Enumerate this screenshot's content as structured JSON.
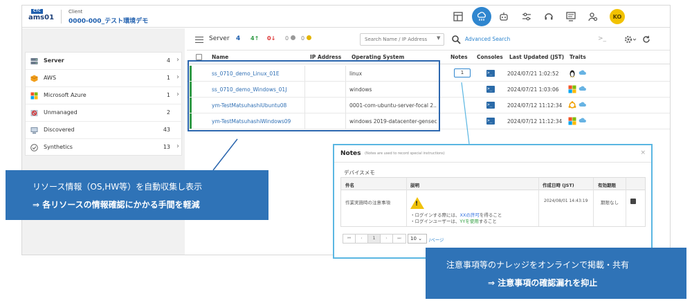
{
  "header": {
    "logo_top": "CTC",
    "logo_text": "ams01",
    "client_label": "Client",
    "client_name": "0000-000_テスト環境デモ",
    "avatar_initials": "KO",
    "accent": "#2f86cf"
  },
  "sidebar": {
    "items": [
      {
        "label": "Server",
        "count": "4",
        "chevron": "›",
        "icon": "server-icon"
      },
      {
        "label": "AWS",
        "count": "1",
        "chevron": "›",
        "icon": "aws-icon"
      },
      {
        "label": "Microsoft Azure",
        "count": "1",
        "chevron": "›",
        "icon": "windows-icon"
      },
      {
        "label": "Unmanaged",
        "count": "2",
        "chevron": "",
        "icon": "unmanaged-icon"
      },
      {
        "label": "Discovered",
        "count": "43",
        "chevron": "",
        "icon": "discovered-icon"
      },
      {
        "label": "Synthetics",
        "count": "13",
        "chevron": "›",
        "icon": "synthetics-icon"
      }
    ]
  },
  "toolbar": {
    "title": "Server",
    "count": "4",
    "up_count": "4",
    "down_count": "0",
    "unknown_count": "0",
    "question_count": "0",
    "search_placeholder": "Search Name / IP Address",
    "advanced_search": "Advanced Search",
    "console_glyph": ">_"
  },
  "table": {
    "headers": {
      "name": "Name",
      "ip": "IP Address",
      "os": "Operating System",
      "notes": "Notes",
      "consoles": "Consoles",
      "updated": "Last Updated (JST)",
      "traits": "Traits"
    },
    "rows": [
      {
        "name": "ss_0710_demo_Linux_01E",
        "ip": "",
        "os": "linux",
        "notes": "1",
        "updated": "2024/07/21 1:02:52",
        "trait": "linux"
      },
      {
        "name": "ss_0710_demo_Windows_01J",
        "ip": "",
        "os": "windows",
        "notes": "",
        "updated": "2024/07/21 1:03:06",
        "trait": "windows"
      },
      {
        "name": "ym-TestMatsuhashiUbuntu08",
        "ip": "",
        "os": "0001-com-ubuntu-server-focal 2...",
        "notes": "",
        "updated": "2024/07/12 11:12:34",
        "trait": "ubuntu"
      },
      {
        "name": "ym-TestMatsuhashiWindows09",
        "ip": "",
        "os": "windows 2019-datacenter-gensec...",
        "notes": "",
        "updated": "2024/07/12 11:12:34",
        "trait": "windows"
      }
    ]
  },
  "notes_popup": {
    "title": "Notes",
    "subtitle": "(Notes are used to record special instructions)",
    "close": "×",
    "memo_title": "デバイスメモ",
    "headers": {
      "subject": "件名",
      "description": "説明",
      "created": "作成日時 (JST)",
      "expiry": "有効期限"
    },
    "row": {
      "subject": "作業実施時の注意事項",
      "line1_prefix": "・ログインする際には、",
      "line1_highlight": "XXの許可",
      "line1_suffix": "を得ること",
      "line2_prefix": "・ログインユーザーは、",
      "line2_highlight": "YYを使用",
      "line2_suffix": "すること",
      "created": "2024/08/01 14:43:19",
      "expiry": "期限なし"
    },
    "pager": {
      "first": "⏮",
      "prev": "‹",
      "page": "1",
      "next": "›",
      "last": "⏭",
      "page_size": "10 ⌄",
      "per_page": "/ページ"
    }
  },
  "callout_left": {
    "line1": "リソース情報（OS,HW等）を自動収集し表示",
    "line2": "⇒  各リソースの情報確認にかかる手間を軽減"
  },
  "callout_right": {
    "line1": "注意事項等のナレッジをオンラインで掲載・共有",
    "line2": "⇒  注意事項の確認漏れを抑止"
  }
}
